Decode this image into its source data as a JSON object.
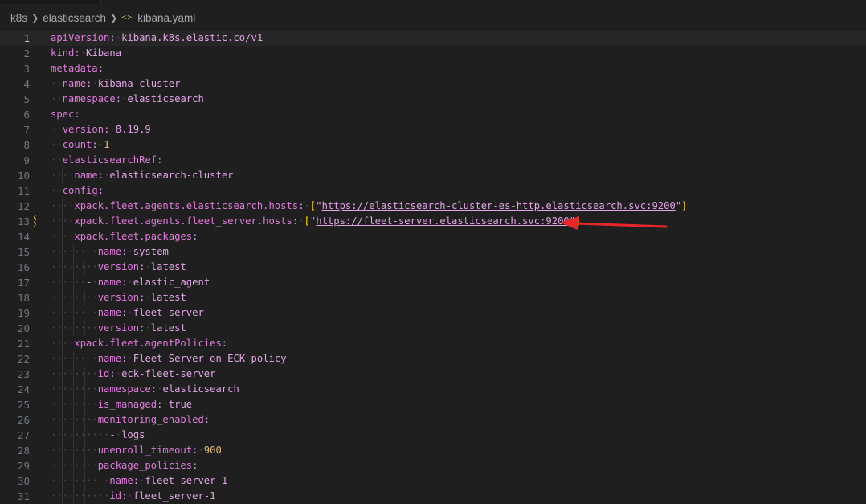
{
  "breadcrumb": {
    "items": [
      "k8s",
      "elasticsearch",
      "kibana.yaml"
    ],
    "file_icon": "yaml-file-icon"
  },
  "editor": {
    "current_line": 1,
    "modified_line": 13,
    "lines": [
      {
        "n": "1",
        "indent": 0,
        "key": "apiVersion",
        "value": "kibana.k8s.elastic.co/v1",
        "type": "str"
      },
      {
        "n": "2",
        "indent": 0,
        "key": "kind",
        "value": "Kibana",
        "type": "str"
      },
      {
        "n": "3",
        "indent": 0,
        "key": "metadata",
        "value": "",
        "type": "none"
      },
      {
        "n": "4",
        "indent": 2,
        "key": "name",
        "value": "kibana-cluster",
        "type": "str"
      },
      {
        "n": "5",
        "indent": 2,
        "key": "namespace",
        "value": "elasticsearch",
        "type": "str"
      },
      {
        "n": "6",
        "indent": 0,
        "key": "spec",
        "value": "",
        "type": "none"
      },
      {
        "n": "7",
        "indent": 2,
        "key": "version",
        "value": "8.19.9",
        "type": "str"
      },
      {
        "n": "8",
        "indent": 2,
        "key": "count",
        "value": "1",
        "type": "num"
      },
      {
        "n": "9",
        "indent": 2,
        "key": "elasticsearchRef",
        "value": "",
        "type": "none"
      },
      {
        "n": "10",
        "indent": 4,
        "key": "name",
        "value": "elasticsearch-cluster",
        "type": "str"
      },
      {
        "n": "11",
        "indent": 2,
        "key": "config",
        "value": "",
        "type": "none"
      },
      {
        "n": "12",
        "indent": 4,
        "key": "xpack.fleet.agents.elasticsearch.hosts",
        "value": "https://elasticsearch-cluster-es-http.elasticsearch.svc:9200",
        "type": "urllist"
      },
      {
        "n": "13",
        "indent": 4,
        "key": "xpack.fleet.agents.fleet_server.hosts",
        "value": "https://fleet-server.elasticsearch.svc:9200",
        "type": "urllist"
      },
      {
        "n": "14",
        "indent": 4,
        "key": "xpack.fleet.packages",
        "value": "",
        "type": "none"
      },
      {
        "n": "15",
        "indent": 6,
        "dash": true,
        "key": "name",
        "value": "system",
        "type": "str"
      },
      {
        "n": "16",
        "indent": 8,
        "key": "version",
        "value": "latest",
        "type": "str"
      },
      {
        "n": "17",
        "indent": 6,
        "dash": true,
        "key": "name",
        "value": "elastic_agent",
        "type": "str"
      },
      {
        "n": "18",
        "indent": 8,
        "key": "version",
        "value": "latest",
        "type": "str"
      },
      {
        "n": "19",
        "indent": 6,
        "dash": true,
        "key": "name",
        "value": "fleet_server",
        "type": "str"
      },
      {
        "n": "20",
        "indent": 8,
        "key": "version",
        "value": "latest",
        "type": "str"
      },
      {
        "n": "21",
        "indent": 4,
        "key": "xpack.fleet.agentPolicies",
        "value": "",
        "type": "none"
      },
      {
        "n": "22",
        "indent": 6,
        "dash": true,
        "key": "name",
        "value": "Fleet Server on ECK policy",
        "type": "str"
      },
      {
        "n": "23",
        "indent": 8,
        "key": "id",
        "value": "eck-fleet-server",
        "type": "str"
      },
      {
        "n": "24",
        "indent": 8,
        "key": "namespace",
        "value": "elasticsearch",
        "type": "str"
      },
      {
        "n": "25",
        "indent": 8,
        "key": "is_managed",
        "value": "true",
        "type": "bool"
      },
      {
        "n": "26",
        "indent": 8,
        "key": "monitoring_enabled",
        "value": "",
        "type": "none"
      },
      {
        "n": "27",
        "indent": 10,
        "dash": true,
        "key": "",
        "value": "logs",
        "type": "item"
      },
      {
        "n": "28",
        "indent": 8,
        "key": "unenroll_timeout",
        "value": "900",
        "type": "num"
      },
      {
        "n": "29",
        "indent": 8,
        "key": "package_policies",
        "value": "",
        "type": "none"
      },
      {
        "n": "30",
        "indent": 8,
        "dash": true,
        "key": "name",
        "value": "fleet_server-1",
        "type": "str"
      },
      {
        "n": "31",
        "indent": 10,
        "key": "id",
        "value": "fleet_server-1",
        "type": "str"
      }
    ]
  },
  "colors": {
    "annotation_arrow": "#e8262a"
  }
}
